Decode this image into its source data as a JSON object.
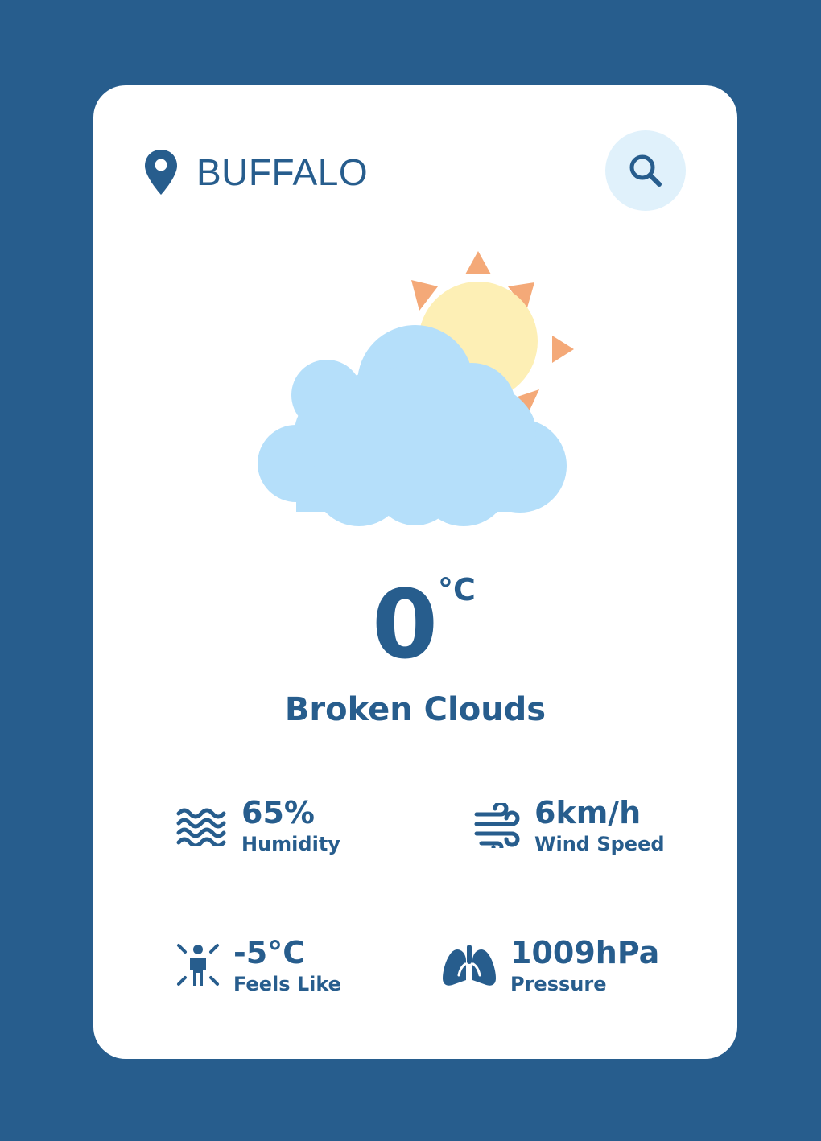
{
  "location": {
    "city": "BUFFALO",
    "icon": "map-pin-icon"
  },
  "search": {
    "icon": "search-icon"
  },
  "weather": {
    "icon": "partly-cloudy-icon",
    "temperature": "0",
    "unit": "°C",
    "condition": "Broken Clouds"
  },
  "stats": {
    "humidity": {
      "value": "65%",
      "label": "Humidity",
      "icon": "waves-icon"
    },
    "wind": {
      "value": "6km/h",
      "label": "Wind Speed",
      "icon": "wind-icon"
    },
    "feels_like": {
      "value": "-5°C",
      "label": "Feels Like",
      "icon": "person-cold-icon"
    },
    "pressure": {
      "value": "1009hPa",
      "label": "Pressure",
      "icon": "lungs-icon"
    }
  },
  "colors": {
    "background": "#275d8d",
    "card": "#ffffff",
    "primary": "#275d8d",
    "search_bg": "#e0f1fb",
    "cloud": "#b5dffa",
    "sun": "#fdefb5",
    "sun_rays": "#f4a978"
  }
}
